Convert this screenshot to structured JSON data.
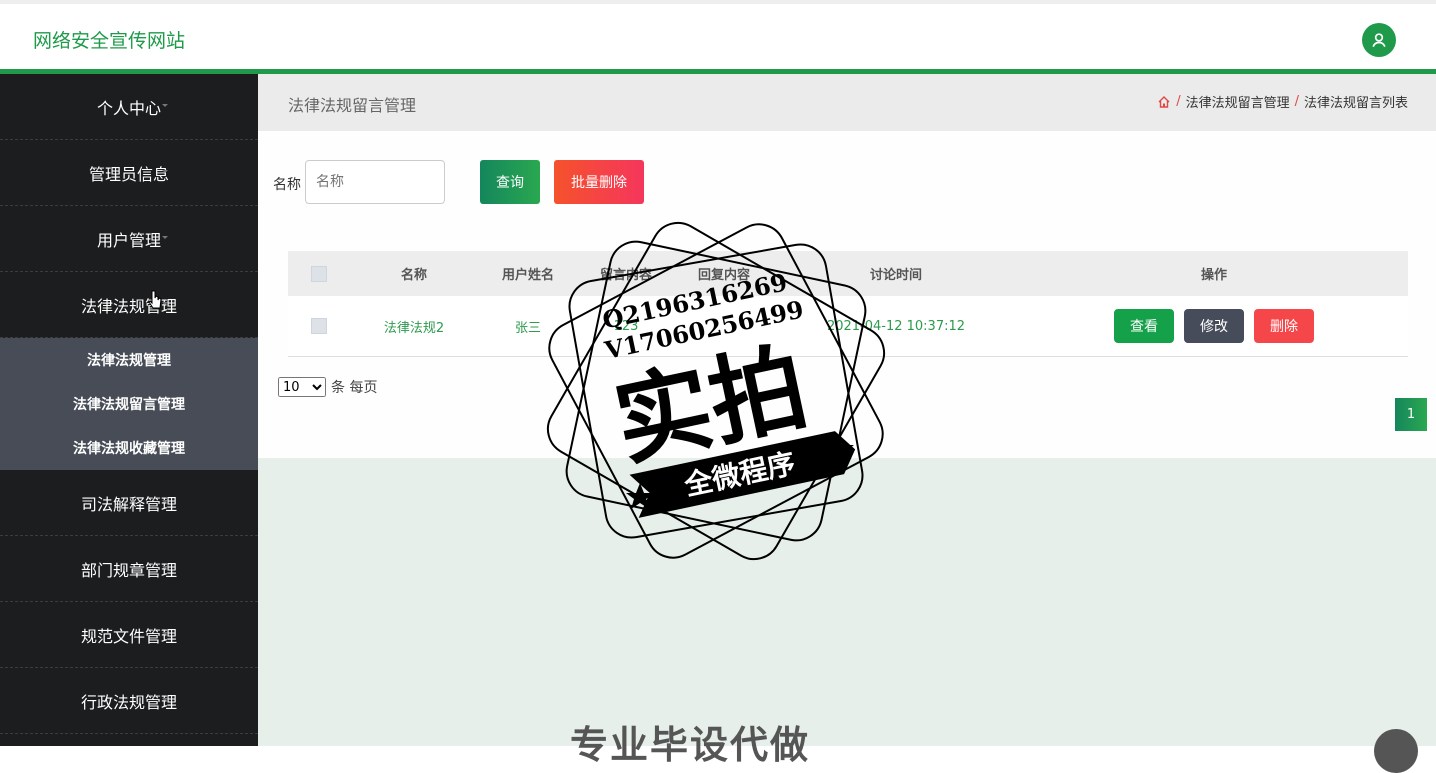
{
  "header": {
    "site_title": "网络安全宣传网站",
    "user_icon": "user-icon",
    "accent_color": "#1e9a4a"
  },
  "sidebar": {
    "items": [
      {
        "label": "个人中心"
      },
      {
        "label": "管理员信息"
      },
      {
        "label": "用户管理"
      },
      {
        "label": "法律法规管理"
      },
      {
        "label": "司法解释管理"
      },
      {
        "label": "部门规章管理"
      },
      {
        "label": "规范文件管理"
      },
      {
        "label": "行政法规管理"
      }
    ],
    "submenu": [
      {
        "label": "法律法规管理"
      },
      {
        "label": "法律法规留言管理"
      },
      {
        "label": "法律法规收藏管理"
      }
    ]
  },
  "breadcrumb": {
    "title": "法律法规留言管理",
    "home_icon": "home-icon",
    "separator": "/",
    "items": [
      "法律法规留言管理",
      "法律法规留言列表"
    ]
  },
  "search": {
    "label": "名称",
    "placeholder": "名称",
    "query_label": "查询",
    "batch_delete_label": "批量删除"
  },
  "table": {
    "columns": [
      "名称",
      "用户姓名",
      "留言内容",
      "回复内容",
      "讨论时间",
      "操作"
    ],
    "rows": [
      {
        "name": "法律法规2",
        "user_name": "张三",
        "message": "123",
        "reply": "",
        "time": "2021-04-12 10:37:12",
        "actions": {
          "view": "查看",
          "edit": "修改",
          "delete": "删除"
        }
      }
    ]
  },
  "pagination": {
    "page_size": "10",
    "page_size_options": [
      "10"
    ],
    "per_page_label": "条 每页",
    "current_page": "1"
  },
  "watermark": {
    "line1": "Q2196316269",
    "line2": "V17060256499",
    "main": "实拍",
    "banner": "全微程序"
  },
  "bottom_banner_text": "专业毕设代做"
}
